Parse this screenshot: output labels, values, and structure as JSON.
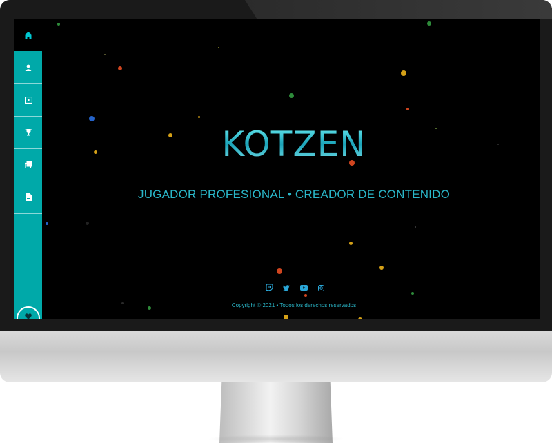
{
  "sidebar": {
    "home_icon": "home-icon",
    "items": [
      {
        "icon": "user-icon",
        "glyph": "👤"
      },
      {
        "icon": "video-icon",
        "glyph": "▶"
      },
      {
        "icon": "trophy-icon",
        "glyph": "🏆"
      },
      {
        "icon": "gallery-icon",
        "glyph": "▤"
      },
      {
        "icon": "document-icon",
        "glyph": "▥"
      }
    ],
    "heart_icon": "heart-icon"
  },
  "hero": {
    "title": "KOTZEN",
    "subtitle": "JUGADOR PROFESIONAL • CREADOR DE CONTENIDO"
  },
  "social": [
    {
      "name": "twitch-icon",
      "glyph": "▯"
    },
    {
      "name": "twitter-icon",
      "glyph": "✦"
    },
    {
      "name": "youtube-icon",
      "glyph": "▶"
    },
    {
      "name": "instagram-icon",
      "glyph": "◎"
    }
  ],
  "footer": {
    "copyright": "Copyright © 2021 • Todos los derechos reservados"
  },
  "colors": {
    "accent": "#00a9a9",
    "title": "#38d6e2",
    "text": "#2ab7c9",
    "background": "#000000"
  }
}
